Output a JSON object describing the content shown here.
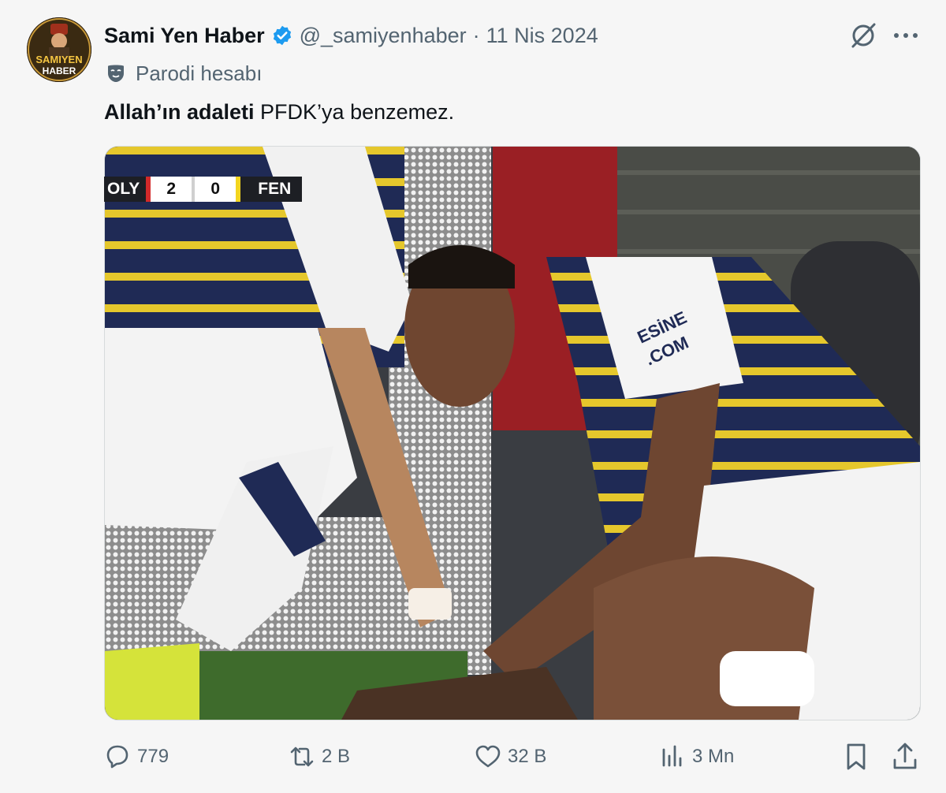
{
  "tweet": {
    "author": {
      "name": "Sami Yen Haber",
      "handle": "@_samiyenhaber",
      "avatar_text_top": "SAMIYEN",
      "avatar_text_bottom": "HABER",
      "verified_icon": "verified-badge-icon",
      "verified_color": "#1d9bf0"
    },
    "separator": "·",
    "date": "11 Nis 2024",
    "label": "Parodi hesabı",
    "text_bold": "Allah’ın adaleti",
    "text_rest": " PFDK’ya benzemez.",
    "media": {
      "scoreboard": {
        "home": "OLY",
        "home_score": "2",
        "away_score": "0",
        "away": "FEN"
      },
      "sleeve_text_1": "ESİNE",
      "sleeve_text_2": ".COM"
    },
    "actions": {
      "replies": "779",
      "reposts": "2 B",
      "likes": "32 B",
      "views": "3 Mn"
    }
  },
  "colors": {
    "muted": "#536471",
    "text": "#0f1419",
    "background": "#f6f6f6"
  }
}
